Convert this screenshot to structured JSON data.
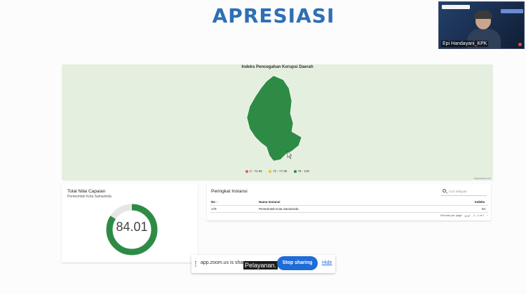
{
  "slide": {
    "title": "APRESIASI"
  },
  "video": {
    "participant_name": "Epi Handayani_KPK"
  },
  "map": {
    "title": "Indeks Pencegahan Korupsi Daerah",
    "legend": [
      {
        "label": "0 - 72.99",
        "color": "#e05a5a"
      },
      {
        "label": "73 - 77.99",
        "color": "#e8c43a"
      },
      {
        "label": "78 - 100",
        "color": "#2e8b46"
      }
    ],
    "region_color": "#2e8b46",
    "credit": "Highcharts.com"
  },
  "total": {
    "title": "Total Nilai Capaian",
    "subtitle": "Pemerintah Kota Samarinda",
    "value": "84.01",
    "gauge_percent": 84.01,
    "gauge_color": "#2e8b46"
  },
  "table": {
    "title": "Peringkat Instansi",
    "search_placeholder": "Cari Wilayah",
    "columns": {
      "no": "No ↑",
      "name": "Nama Instansi",
      "index": "Indeks"
    },
    "rows": [
      {
        "no": "179",
        "name": "Pemerintah Kota Samarinda",
        "index": "84"
      }
    ],
    "records_label": "Records per page:",
    "records_value": "10 ▾",
    "range": "1 - 1 of 1",
    "prev": "‹",
    "next": "›"
  },
  "zoom_bar": {
    "sharing_text": "app.zoom.us is sharin",
    "caption": "Pelayanan.",
    "stop_label": "Stop sharing",
    "hide_label": "Hide"
  }
}
